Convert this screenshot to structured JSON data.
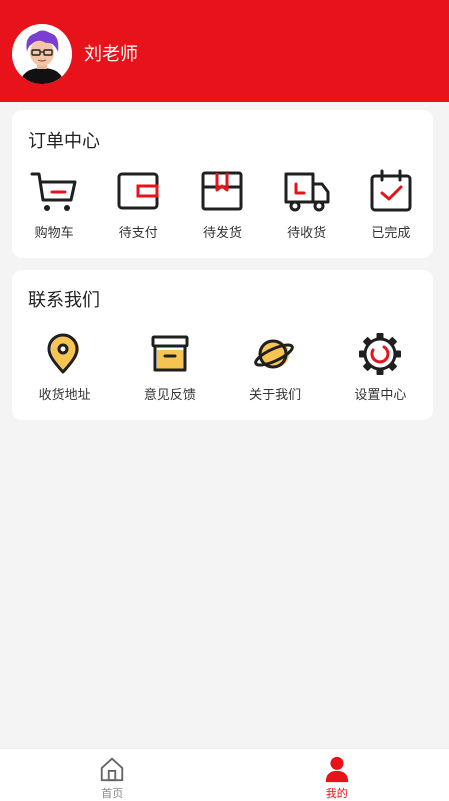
{
  "profile": {
    "name": "刘老师"
  },
  "orders": {
    "title": "订单中心",
    "items": [
      {
        "label": "购物车",
        "icon": "cart-icon"
      },
      {
        "label": "待支付",
        "icon": "wallet-icon"
      },
      {
        "label": "待发货",
        "icon": "package-icon"
      },
      {
        "label": "待收货",
        "icon": "truck-icon"
      },
      {
        "label": "已完成",
        "icon": "calendar-check-icon"
      }
    ]
  },
  "contact": {
    "title": "联系我们",
    "items": [
      {
        "label": "收货地址",
        "icon": "location-pin-icon"
      },
      {
        "label": "意见反馈",
        "icon": "archive-box-icon"
      },
      {
        "label": "关于我们",
        "icon": "planet-icon"
      },
      {
        "label": "设置中心",
        "icon": "gear-icon"
      }
    ]
  },
  "tabbar": {
    "home": "首页",
    "mine": "我的"
  },
  "colors": {
    "brand": "#e8131a",
    "accent_yellow": "#f6c451",
    "icon_dark": "#1f1f1f"
  }
}
